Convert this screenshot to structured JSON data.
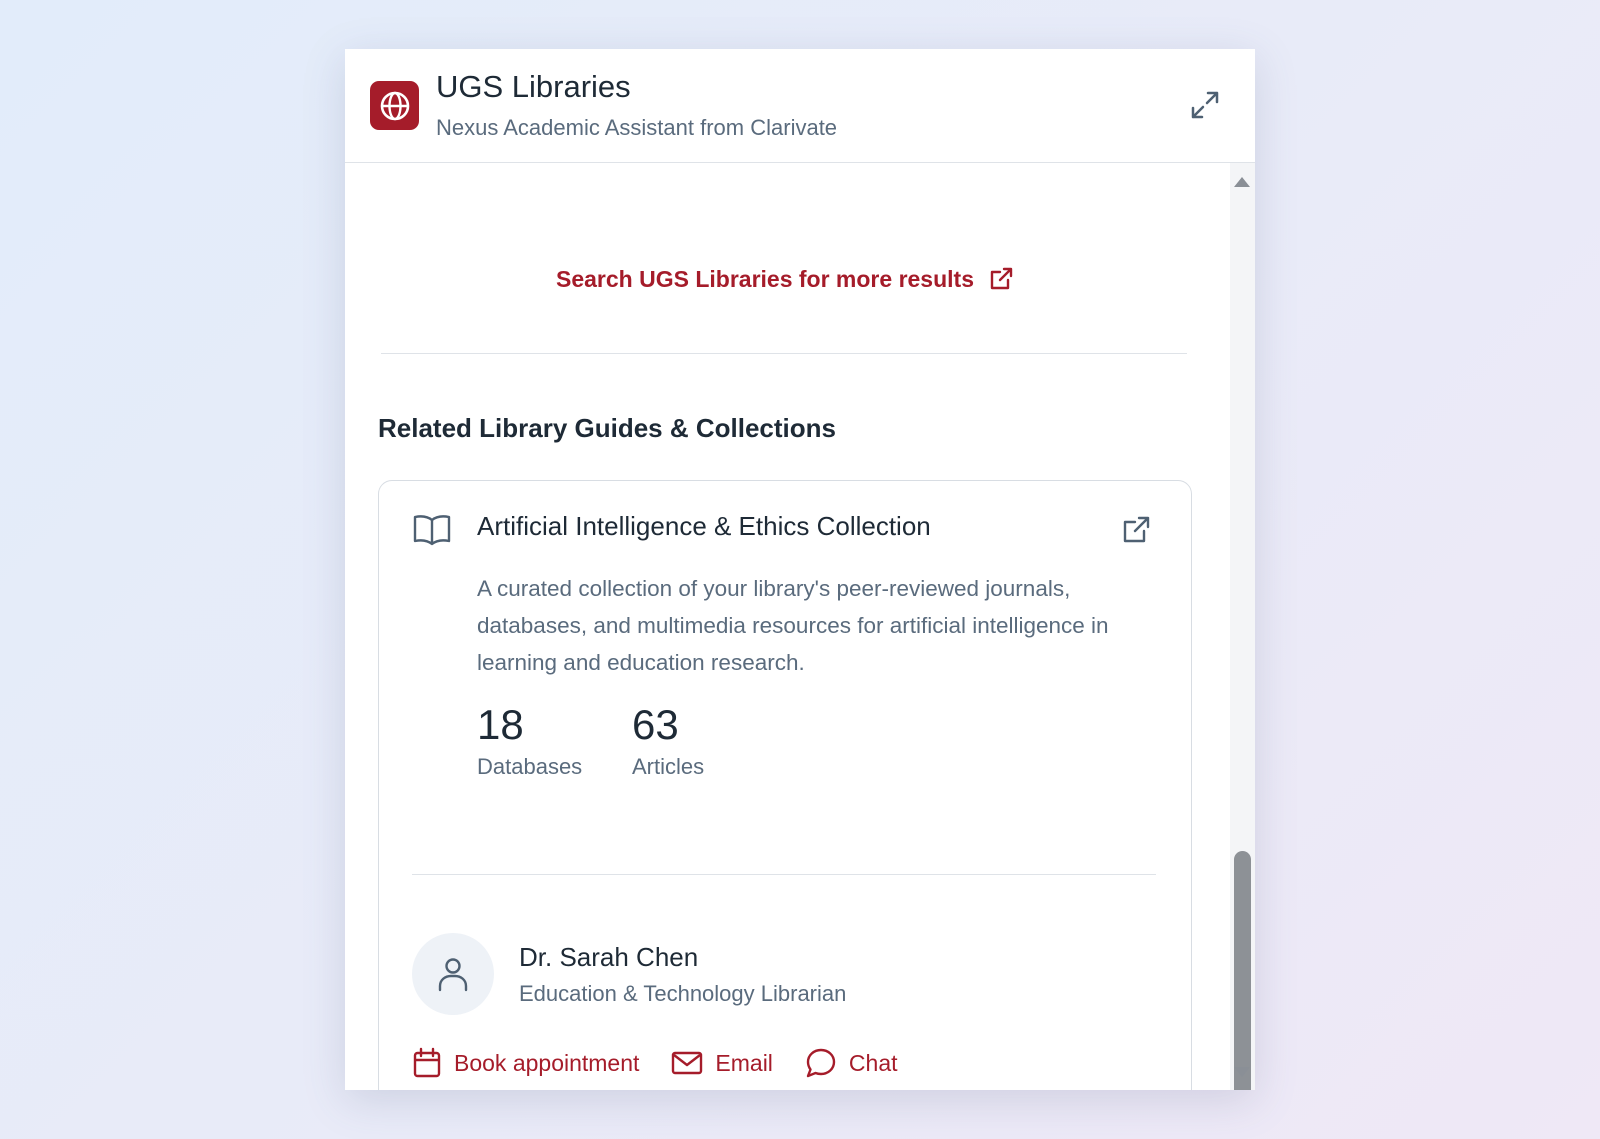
{
  "header": {
    "title": "UGS Libraries",
    "subtitle": "Nexus Academic Assistant from Clarivate",
    "logo_icon": "globe-icon",
    "expand_icon": "expand-icon"
  },
  "search_link": {
    "label": "Search UGS Libraries for more results",
    "icon": "external-link-icon"
  },
  "related": {
    "section_title": "Related Library Guides & Collections",
    "card": {
      "icon": "book-open-icon",
      "title": "Artificial Intelligence & Ethics Collection",
      "description": "A curated collection of your library's peer-reviewed journals, databases, and multimedia resources for artificial intelligence in learning and education research.",
      "stats": [
        {
          "value": "18",
          "label": "Databases"
        },
        {
          "value": "63",
          "label": "Articles"
        }
      ],
      "contact": {
        "name": "Dr. Sarah Chen",
        "role": "Education & Technology Librarian",
        "avatar_icon": "user-icon"
      },
      "actions": [
        {
          "label": "Book appointment",
          "icon": "calendar-icon"
        },
        {
          "label": "Email",
          "icon": "mail-icon"
        },
        {
          "label": "Chat",
          "icon": "chat-bubble-icon"
        }
      ]
    }
  },
  "colors": {
    "accent": "#a51c2a",
    "text_primary": "#1e2a36",
    "text_secondary": "#5a6b7d",
    "background": "#e6ecf9"
  }
}
